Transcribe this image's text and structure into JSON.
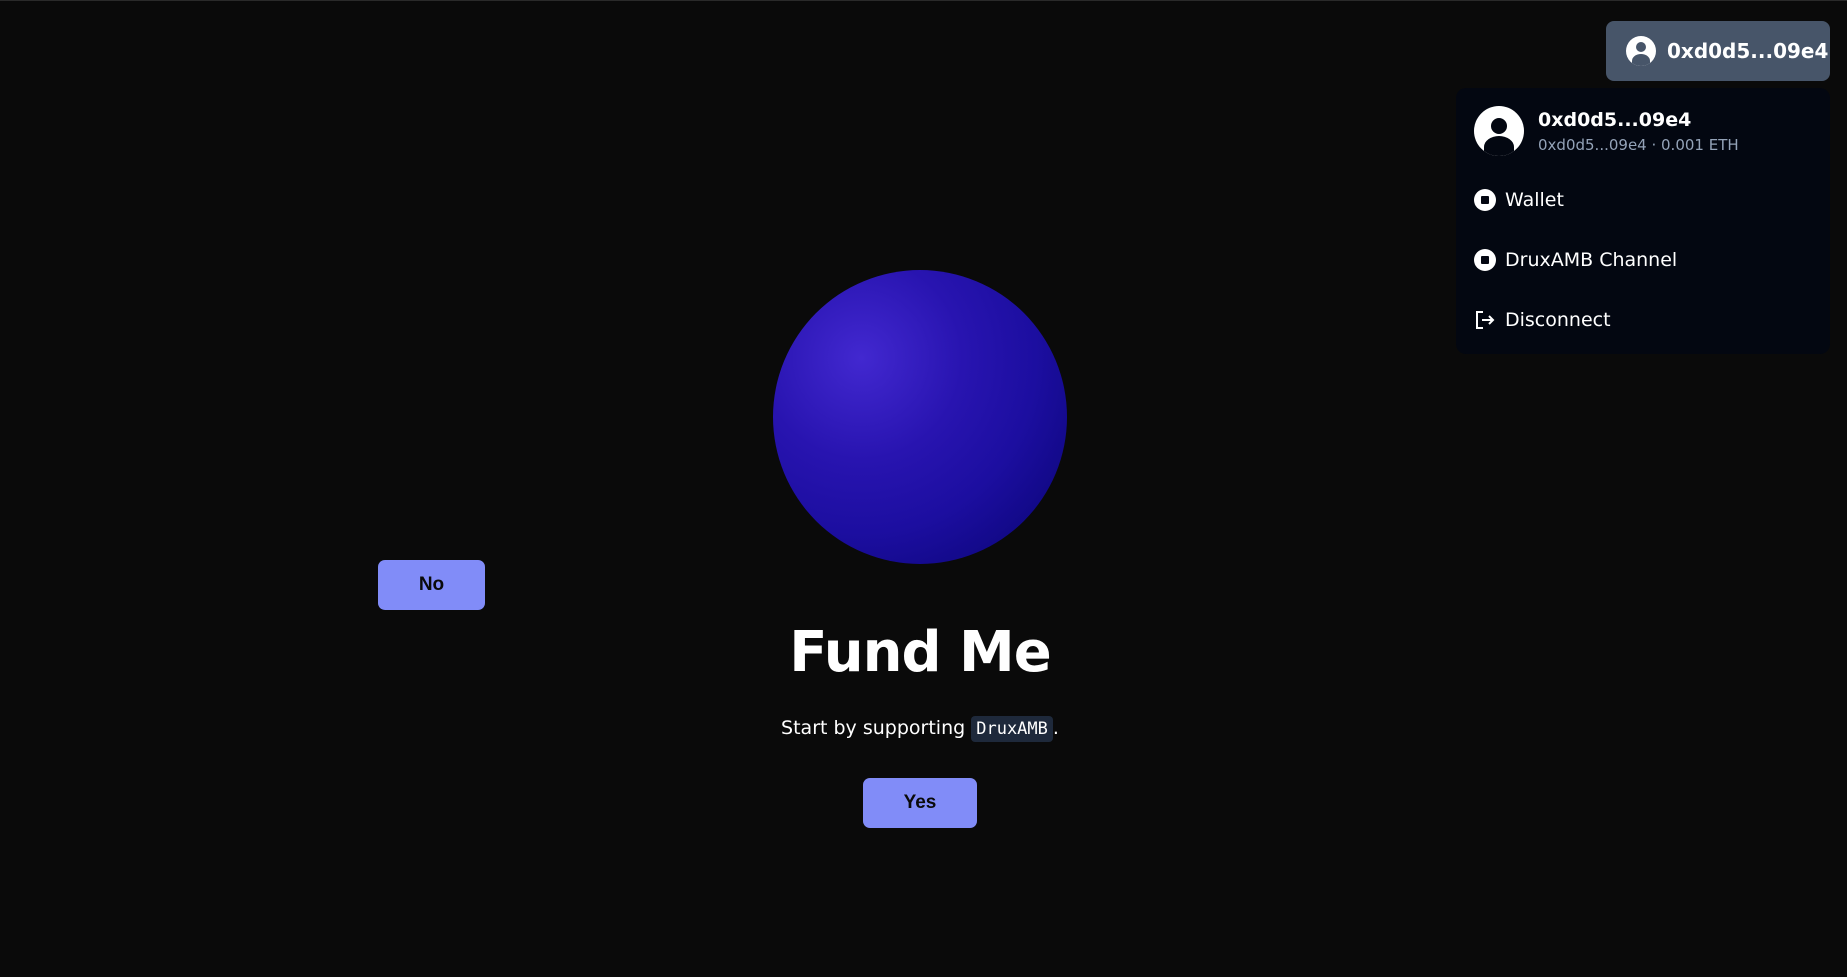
{
  "account_button": {
    "label": "0xd0d5...09e4",
    "icon": "user-avatar-icon"
  },
  "dropdown": {
    "name": "0xd0d5...09e4",
    "subtitle": "0xd0d5...09e4 · 0.001 ETH",
    "items": [
      {
        "label": "Wallet",
        "icon": "wallet-icon"
      },
      {
        "label": "DruxAMB Channel",
        "icon": "channel-icon"
      },
      {
        "label": "Disconnect",
        "icon": "disconnect-icon"
      }
    ]
  },
  "main": {
    "title": "Fund Me",
    "subtitle_prefix": "Start by supporting",
    "subtitle_code": "DruxAMB",
    "subtitle_suffix": ".",
    "no_label": "No",
    "yes_label": "Yes"
  },
  "colors": {
    "background": "#0a0a0a",
    "accent": "#818cf8",
    "account_button": "#475569",
    "dropdown": "#030711",
    "sphere": "#2814b0"
  }
}
